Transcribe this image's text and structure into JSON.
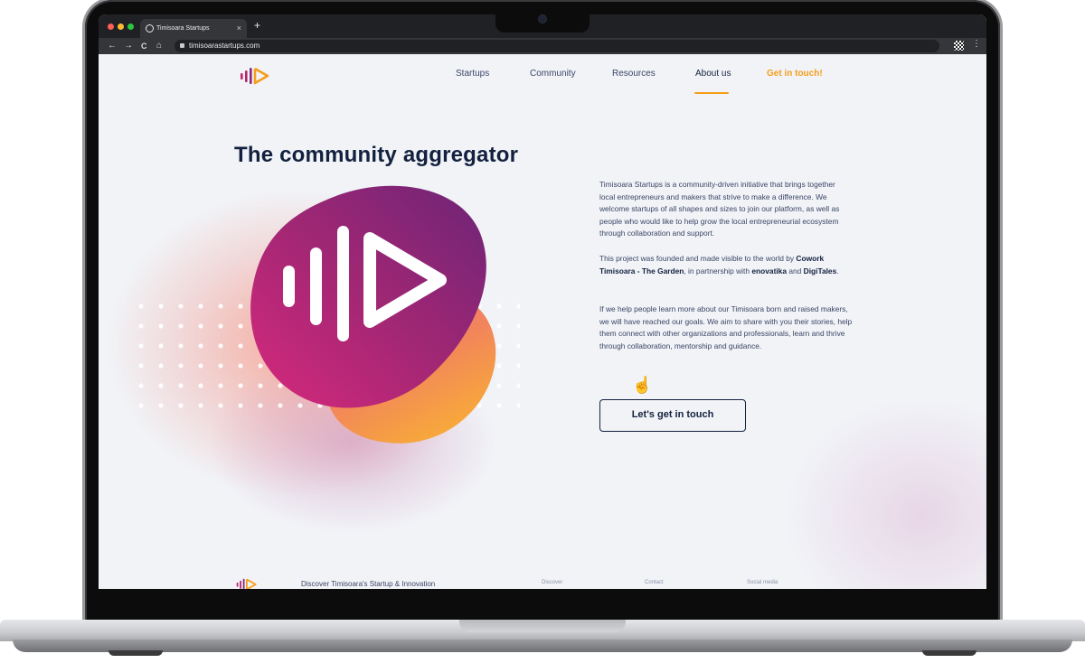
{
  "browser": {
    "tab_title": "Timisoara Startups",
    "tab_close": "×",
    "new_tab": "+",
    "url": "timisoarastartups.com",
    "back": "←",
    "forward": "→",
    "reload": "C",
    "home": "⌂",
    "menu": "⋮",
    "traffic_lights": {
      "close": "#ff5f57",
      "minimize": "#febc2e",
      "maximize": "#28c840"
    }
  },
  "nav": {
    "items": [
      {
        "label": "Startups"
      },
      {
        "label": "Community"
      },
      {
        "label": "Resources"
      },
      {
        "label": "About us",
        "active": true
      },
      {
        "label": "Get in touch!"
      }
    ]
  },
  "hero": {
    "title": "The community aggregator",
    "paragraph1": "Timisoara Startups is a community-driven initiative that brings together local entrepreneurs and makers that strive to make a difference. We welcome startups of all shapes and sizes to join our platform, as well as people who would like to help grow the local entrepreneurial ecosystem through collaboration and support.",
    "paragraph2_prefix": "This project was founded and made visible to the world by ",
    "paragraph2_org1": "Cowork Timisoara - The Garden",
    "paragraph2_mid": ", in partnership with ",
    "paragraph2_org2": "enovatika",
    "paragraph2_and": " and ",
    "paragraph2_org3": "DigiTales",
    "paragraph2_end": ".",
    "paragraph3": "If we help people learn more about our Timisoara born and raised makers, we will have reached our goals. We aim to share with you their stories, help them connect with other organizations and professionals, learn and thrive through collaboration, mentorship and guidance.",
    "button_label": "Let's get in touch"
  },
  "footer": {
    "tagline": "Discover Timisoara's Startup & Innovation",
    "columns": [
      "Discover",
      "Contact",
      "Social media"
    ]
  },
  "colors": {
    "accent": "#f59e1b",
    "navy": "#13213f",
    "magenta": "#c2246e",
    "purple": "#7a2378"
  }
}
